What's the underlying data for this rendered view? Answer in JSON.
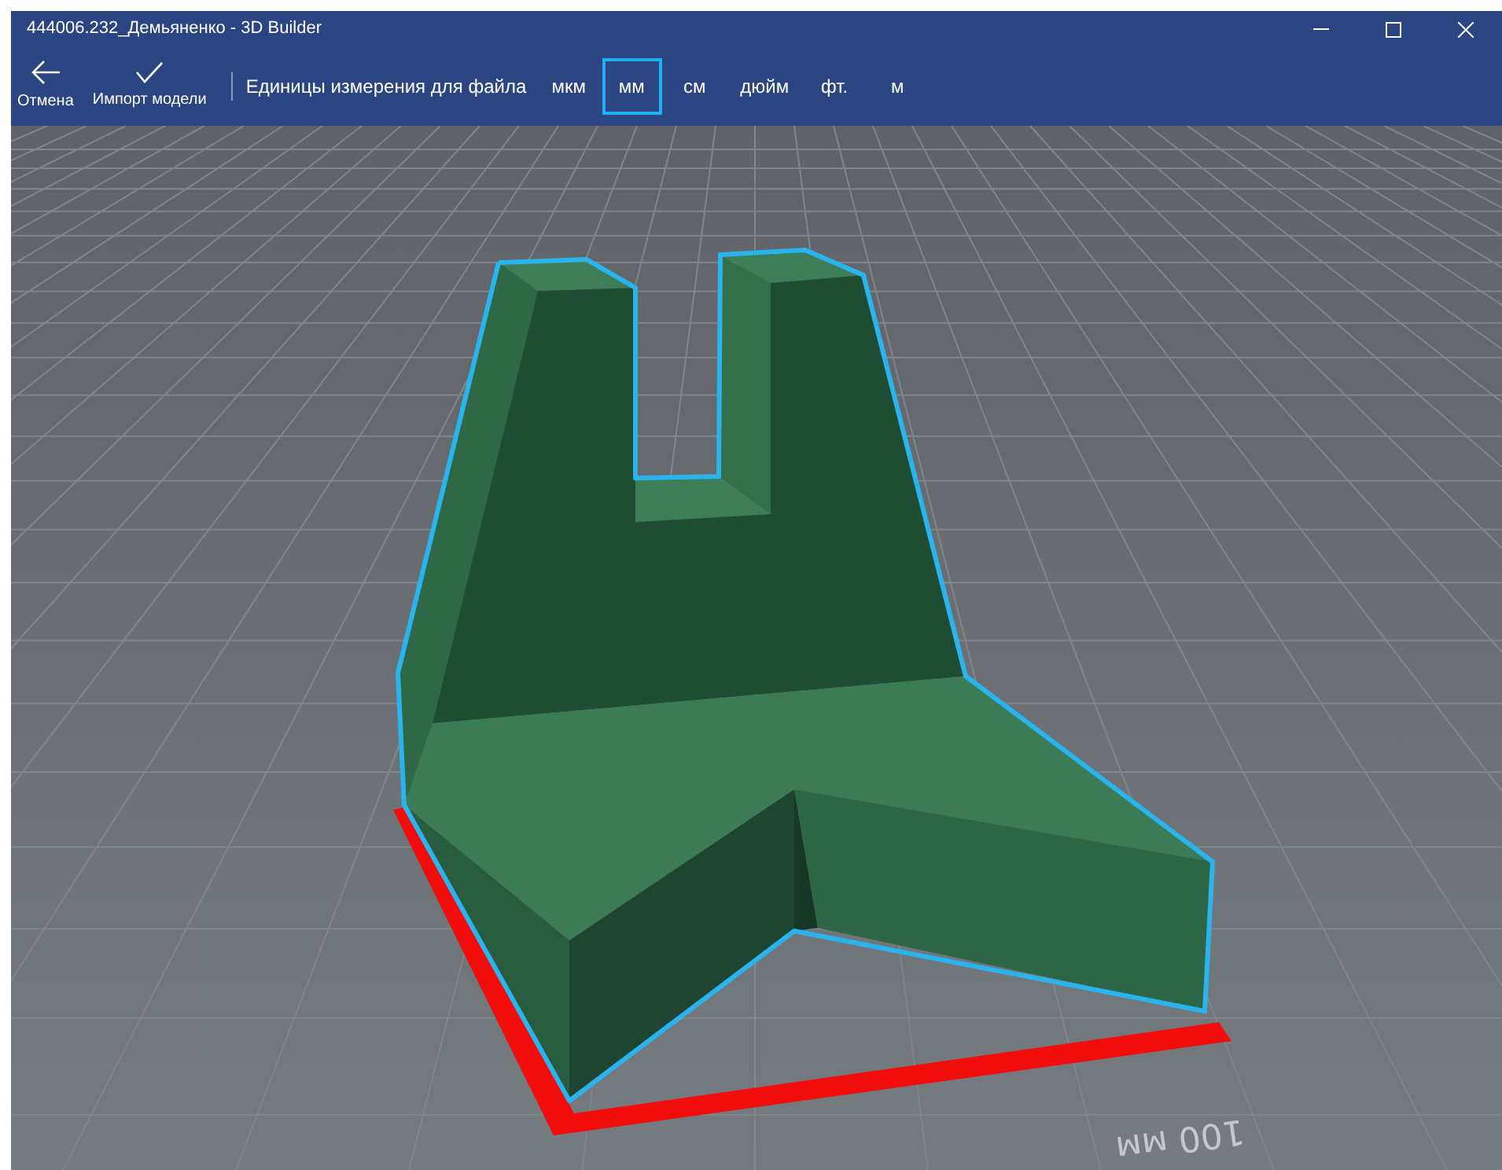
{
  "window": {
    "title": "444006.232_Демьяненко - 3D Builder"
  },
  "toolbar": {
    "buttons": [
      {
        "label": "Отмена",
        "kind": "back"
      },
      {
        "label": "Импорт модели",
        "kind": "check"
      }
    ],
    "units_label": "Единицы измерения для файла",
    "units": [
      {
        "label": "мкм",
        "selected": false
      },
      {
        "label": "мм",
        "selected": true
      },
      {
        "label": "см",
        "selected": false
      },
      {
        "label": "дюйм",
        "selected": false
      },
      {
        "label": "фт.",
        "selected": false
      },
      {
        "label": "м",
        "selected": false
      }
    ]
  },
  "viewport": {
    "scale_label": "100 мм"
  }
}
